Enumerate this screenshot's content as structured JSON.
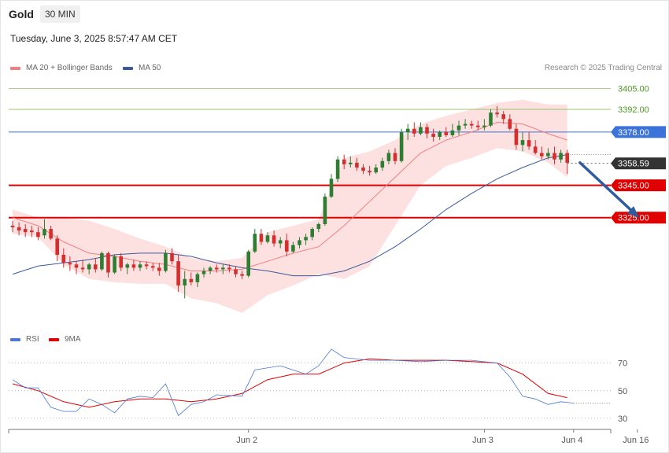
{
  "header": {
    "symbol": "Gold",
    "timeframe": "30 MIN",
    "datetime": "Tuesday, June 3, 2025 8:57:47 AM CET"
  },
  "legend": {
    "ma20_label": "MA 20 + Bollinger Bands",
    "ma50_label": "MA 50",
    "rsi_label": "RSI",
    "ma9_label": "9MA"
  },
  "credit": "Research © 2025 Trading Central",
  "colors": {
    "up": "#2e7d32",
    "down": "#d32f2f",
    "ma20": "#f08080",
    "bands_fill": "#fde0e0",
    "ma50": "#3a5a9a",
    "support": "#e00000",
    "pivot": "#3b73d8",
    "resistance": "#90c060",
    "arrow": "#2e5c9e",
    "rsi": "#4a78d4",
    "rsi_ma": "#e00000"
  },
  "chart_data": [
    {
      "type": "candlestick",
      "title": "",
      "xlabel": "",
      "ylabel": "",
      "ylim": [
        3264,
        3412
      ],
      "x_ticks": [
        {
          "label": "Jun 2",
          "index": 37
        },
        {
          "label": "Jun 3",
          "index": 74
        },
        {
          "label": "Jun 4",
          "index": 88
        },
        {
          "label": "Jun 16",
          "index": 98
        }
      ],
      "candles": [
        [
          3320,
          3323,
          3316,
          3319
        ],
        [
          3319,
          3322,
          3314,
          3317
        ],
        [
          3318,
          3321,
          3313,
          3316
        ],
        [
          3317,
          3320,
          3313,
          3316
        ],
        [
          3316,
          3319,
          3311,
          3313
        ],
        [
          3314,
          3324,
          3312,
          3318
        ],
        [
          3318,
          3320,
          3311,
          3312
        ],
        [
          3312,
          3314,
          3298,
          3302
        ],
        [
          3302,
          3306,
          3294,
          3297
        ],
        [
          3297,
          3301,
          3292,
          3296
        ],
        [
          3296,
          3298,
          3290,
          3294
        ],
        [
          3294,
          3299,
          3291,
          3293
        ],
        [
          3293,
          3297,
          3290,
          3296
        ],
        [
          3296,
          3300,
          3291,
          3293
        ],
        [
          3293,
          3304,
          3292,
          3303
        ],
        [
          3303,
          3304,
          3288,
          3291
        ],
        [
          3291,
          3302,
          3290,
          3301
        ],
        [
          3301,
          3303,
          3292,
          3294
        ],
        [
          3294,
          3297,
          3290,
          3296
        ],
        [
          3296,
          3299,
          3292,
          3294
        ],
        [
          3294,
          3298,
          3292,
          3296
        ],
        [
          3296,
          3298,
          3293,
          3295
        ],
        [
          3295,
          3297,
          3292,
          3294
        ],
        [
          3294,
          3297,
          3289,
          3292
        ],
        [
          3292,
          3305,
          3291,
          3303
        ],
        [
          3303,
          3306,
          3296,
          3298
        ],
        [
          3298,
          3302,
          3279,
          3283
        ],
        [
          3283,
          3292,
          3275,
          3287
        ],
        [
          3287,
          3291,
          3283,
          3285
        ],
        [
          3285,
          3291,
          3282,
          3290
        ],
        [
          3290,
          3294,
          3288,
          3292
        ],
        [
          3292,
          3295,
          3290,
          3294
        ],
        [
          3294,
          3296,
          3291,
          3293
        ],
        [
          3293,
          3296,
          3290,
          3294
        ],
        [
          3294,
          3296,
          3291,
          3293
        ],
        [
          3293,
          3295,
          3288,
          3290
        ],
        [
          3290,
          3292,
          3287,
          3289
        ],
        [
          3289,
          3305,
          3288,
          3304
        ],
        [
          3304,
          3318,
          3303,
          3315
        ],
        [
          3315,
          3318,
          3308,
          3310
        ],
        [
          3310,
          3316,
          3309,
          3314
        ],
        [
          3314,
          3317,
          3307,
          3309
        ],
        [
          3309,
          3313,
          3306,
          3311
        ],
        [
          3311,
          3315,
          3301,
          3304
        ],
        [
          3304,
          3310,
          3303,
          3308
        ],
        [
          3308,
          3313,
          3306,
          3311
        ],
        [
          3311,
          3315,
          3308,
          3313
        ],
        [
          3313,
          3319,
          3311,
          3318
        ],
        [
          3318,
          3322,
          3316,
          3321
        ],
        [
          3321,
          3340,
          3320,
          3338
        ],
        [
          3338,
          3352,
          3337,
          3349
        ],
        [
          3349,
          3363,
          3347,
          3361
        ],
        [
          3361,
          3364,
          3355,
          3358
        ],
        [
          3358,
          3363,
          3356,
          3359
        ],
        [
          3359,
          3362,
          3354,
          3356
        ],
        [
          3356,
          3358,
          3352,
          3354
        ],
        [
          3354,
          3357,
          3351,
          3353
        ],
        [
          3353,
          3358,
          3352,
          3356
        ],
        [
          3356,
          3362,
          3354,
          3360
        ],
        [
          3360,
          3367,
          3358,
          3365
        ],
        [
          3365,
          3368,
          3358,
          3360
        ],
        [
          3360,
          3380,
          3359,
          3378
        ],
        [
          3378,
          3383,
          3373,
          3380
        ],
        [
          3380,
          3384,
          3375,
          3377
        ],
        [
          3377,
          3384,
          3376,
          3381
        ],
        [
          3381,
          3383,
          3374,
          3377
        ],
        [
          3377,
          3380,
          3372,
          3375
        ],
        [
          3375,
          3379,
          3373,
          3378
        ],
        [
          3378,
          3381,
          3375,
          3376
        ],
        [
          3376,
          3383,
          3375,
          3379
        ],
        [
          3379,
          3385,
          3376,
          3382
        ],
        [
          3382,
          3386,
          3380,
          3383
        ],
        [
          3383,
          3385,
          3380,
          3382
        ],
        [
          3382,
          3385,
          3379,
          3381
        ],
        [
          3381,
          3386,
          3379,
          3382
        ],
        [
          3382,
          3392,
          3381,
          3390
        ],
        [
          3390,
          3394,
          3387,
          3389
        ],
        [
          3389,
          3391,
          3383,
          3386
        ],
        [
          3386,
          3389,
          3379,
          3380
        ],
        [
          3380,
          3383,
          3367,
          3370
        ],
        [
          3370,
          3378,
          3366,
          3373
        ],
        [
          3373,
          3378,
          3367,
          3369
        ],
        [
          3369,
          3373,
          3364,
          3365
        ],
        [
          3365,
          3369,
          3361,
          3363
        ],
        [
          3363,
          3368,
          3361,
          3365
        ],
        [
          3365,
          3369,
          3358,
          3361
        ],
        [
          3361,
          3367,
          3359,
          3365
        ],
        [
          3365,
          3367,
          3352,
          3359
        ]
      ],
      "ma20": [
        [
          0,
          3325
        ],
        [
          4,
          3320
        ],
        [
          8,
          3310
        ],
        [
          12,
          3303
        ],
        [
          16,
          3301
        ],
        [
          20,
          3298
        ],
        [
          24,
          3296
        ],
        [
          28,
          3292
        ],
        [
          32,
          3292
        ],
        [
          36,
          3293
        ],
        [
          40,
          3298
        ],
        [
          44,
          3303
        ],
        [
          48,
          3307
        ],
        [
          52,
          3320
        ],
        [
          56,
          3335
        ],
        [
          60,
          3350
        ],
        [
          64,
          3365
        ],
        [
          68,
          3373
        ],
        [
          72,
          3378
        ],
        [
          76,
          3384
        ],
        [
          80,
          3383
        ],
        [
          84,
          3377
        ],
        [
          87,
          3373
        ]
      ],
      "bb_upper": [
        [
          0,
          3330
        ],
        [
          4,
          3325
        ],
        [
          8,
          3325
        ],
        [
          12,
          3323
        ],
        [
          16,
          3318
        ],
        [
          20,
          3312
        ],
        [
          24,
          3307
        ],
        [
          28,
          3300
        ],
        [
          32,
          3298
        ],
        [
          36,
          3300
        ],
        [
          40,
          3316
        ],
        [
          44,
          3320
        ],
        [
          48,
          3324
        ],
        [
          52,
          3362
        ],
        [
          56,
          3366
        ],
        [
          60,
          3373
        ],
        [
          64,
          3383
        ],
        [
          68,
          3388
        ],
        [
          72,
          3392
        ],
        [
          76,
          3396
        ],
        [
          80,
          3398
        ],
        [
          84,
          3395
        ],
        [
          87,
          3395
        ]
      ],
      "bb_lower": [
        [
          0,
          3315
        ],
        [
          4,
          3313
        ],
        [
          8,
          3296
        ],
        [
          12,
          3287
        ],
        [
          16,
          3285
        ],
        [
          20,
          3284
        ],
        [
          24,
          3284
        ],
        [
          28,
          3275
        ],
        [
          32,
          3272
        ],
        [
          36,
          3266
        ],
        [
          40,
          3277
        ],
        [
          44,
          3283
        ],
        [
          48,
          3290
        ],
        [
          52,
          3287
        ],
        [
          56,
          3295
        ],
        [
          60,
          3320
        ],
        [
          64,
          3345
        ],
        [
          68,
          3357
        ],
        [
          72,
          3362
        ],
        [
          76,
          3368
        ],
        [
          80,
          3366
        ],
        [
          84,
          3359
        ],
        [
          87,
          3350
        ]
      ],
      "ma50": [
        [
          0,
          3290
        ],
        [
          4,
          3295
        ],
        [
          8,
          3297
        ],
        [
          12,
          3299
        ],
        [
          16,
          3302
        ],
        [
          20,
          3303
        ],
        [
          24,
          3303
        ],
        [
          28,
          3301
        ],
        [
          32,
          3297
        ],
        [
          36,
          3294
        ],
        [
          40,
          3292
        ],
        [
          44,
          3289
        ],
        [
          48,
          3289
        ],
        [
          52,
          3292
        ],
        [
          56,
          3298
        ],
        [
          60,
          3307
        ],
        [
          64,
          3318
        ],
        [
          68,
          3330
        ],
        [
          72,
          3340
        ],
        [
          76,
          3349
        ],
        [
          80,
          3356
        ],
        [
          84,
          3362
        ],
        [
          87,
          3364
        ]
      ],
      "levels": [
        {
          "value": 3405.0,
          "label": "3405.00",
          "role": "resistance"
        },
        {
          "value": 3392.0,
          "label": "3392.00",
          "role": "resistance"
        },
        {
          "value": 3378.0,
          "label": "3378.00",
          "role": "pivot"
        },
        {
          "value": 3358.59,
          "label": "3358.59",
          "role": "last"
        },
        {
          "value": 3345.0,
          "label": "3345.00",
          "role": "support"
        },
        {
          "value": 3325.0,
          "label": "3325.00",
          "role": "support"
        }
      ],
      "forecast_arrow": {
        "from_index": 89,
        "from_value": 3359,
        "to_index": 98,
        "to_value": 3326,
        "direction": "down"
      }
    },
    {
      "type": "line",
      "title": "",
      "xlabel": "",
      "ylabel": "",
      "ylim": [
        22,
        80
      ],
      "y_ticks": [
        70,
        50,
        30
      ],
      "series": [
        {
          "name": "RSI",
          "values": [
            [
              0,
              58
            ],
            [
              2,
              52
            ],
            [
              4,
              52
            ],
            [
              6,
              38
            ],
            [
              8,
              35
            ],
            [
              10,
              35
            ],
            [
              12,
              44
            ],
            [
              14,
              40
            ],
            [
              16,
              34
            ],
            [
              18,
              44
            ],
            [
              20,
              46
            ],
            [
              22,
              45
            ],
            [
              24,
              55
            ],
            [
              26,
              32
            ],
            [
              28,
              40
            ],
            [
              30,
              42
            ],
            [
              32,
              47
            ],
            [
              36,
              46
            ],
            [
              38,
              65
            ],
            [
              42,
              68
            ],
            [
              46,
              62
            ],
            [
              48,
              68
            ],
            [
              50,
              80
            ],
            [
              52,
              74
            ],
            [
              56,
              72
            ],
            [
              60,
              72
            ],
            [
              64,
              71
            ],
            [
              68,
              72
            ],
            [
              72,
              72
            ],
            [
              76,
              70
            ],
            [
              78,
              60
            ],
            [
              80,
              46
            ],
            [
              82,
              44
            ],
            [
              84,
              40
            ],
            [
              86,
              42
            ],
            [
              88,
              41
            ]
          ]
        },
        {
          "name": "9MA",
          "values": [
            [
              0,
              55
            ],
            [
              4,
              50
            ],
            [
              8,
              42
            ],
            [
              12,
              38
            ],
            [
              16,
              42
            ],
            [
              20,
              44
            ],
            [
              24,
              44
            ],
            [
              28,
              42
            ],
            [
              32,
              44
            ],
            [
              36,
              48
            ],
            [
              40,
              58
            ],
            [
              44,
              62
            ],
            [
              48,
              62
            ],
            [
              52,
              70
            ],
            [
              56,
              73
            ],
            [
              60,
              72
            ],
            [
              64,
              72
            ],
            [
              68,
              72
            ],
            [
              72,
              71
            ],
            [
              76,
              70
            ],
            [
              80,
              62
            ],
            [
              84,
              48
            ],
            [
              87,
              45
            ]
          ]
        }
      ]
    }
  ]
}
